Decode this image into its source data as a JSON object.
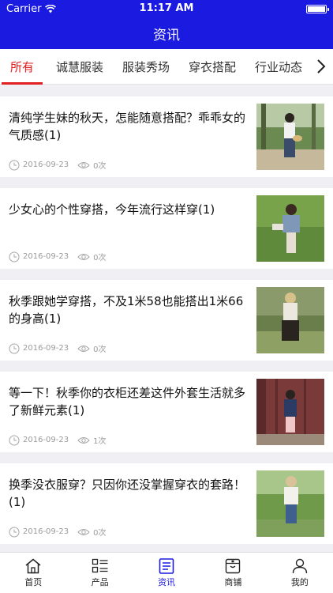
{
  "status": {
    "carrier": "Carrier",
    "time": "11:17 AM"
  },
  "nav": {
    "title": "资讯"
  },
  "tabs": [
    {
      "label": "所有",
      "active": true
    },
    {
      "label": "诚慧服装",
      "active": false
    },
    {
      "label": "服装秀场",
      "active": false
    },
    {
      "label": "穿衣搭配",
      "active": false
    },
    {
      "label": "行业动态",
      "active": false
    }
  ],
  "articles": [
    {
      "title": "清纯学生妹的秋天，怎能随意搭配？乖乖女的气质感(1)",
      "date": "2016-09-23",
      "views": "0次"
    },
    {
      "title": "少女心的个性穿搭，今年流行这样穿(1)",
      "date": "2016-09-23",
      "views": "0次"
    },
    {
      "title": "秋季跟她学穿搭，不及1米58也能搭出1米66的身高(1)",
      "date": "2016-09-23",
      "views": "0次"
    },
    {
      "title": "等一下！秋季你的衣柜还差这件外套生活就多了新鲜元素(1)",
      "date": "2016-09-23",
      "views": "1次"
    },
    {
      "title": "换季没衣服穿？只因你还没掌握穿衣的套路！(1)",
      "date": "2016-09-23",
      "views": "0次"
    }
  ],
  "tabbar": [
    {
      "label": "首页",
      "icon": "home-icon",
      "active": false
    },
    {
      "label": "产品",
      "icon": "product-list-icon",
      "active": false
    },
    {
      "label": "资讯",
      "icon": "news-icon",
      "active": true
    },
    {
      "label": "商铺",
      "icon": "store-icon",
      "active": false
    },
    {
      "label": "我的",
      "icon": "user-icon",
      "active": false
    }
  ],
  "colors": {
    "nav_bg": "#1a1ae0",
    "active_tab": "#e02020",
    "meta_gray": "#9a9a9a"
  }
}
